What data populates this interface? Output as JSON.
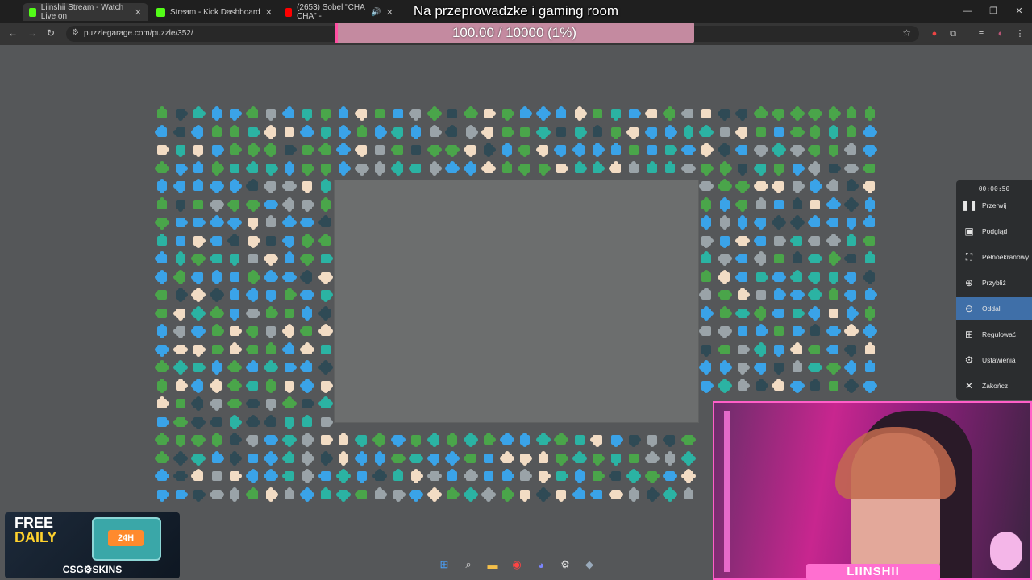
{
  "tabs": [
    {
      "title": "Liinshii Stream - Watch Live on",
      "color": "#53fc18"
    },
    {
      "title": "Stream - Kick Dashboard",
      "color": "#53fc18"
    },
    {
      "title": "(2653) Sobel \"CHA CHA\" - ",
      "color": "#ff0000"
    }
  ],
  "address": {
    "url": "puzzlegarage.com/puzzle/352/"
  },
  "overlay": {
    "title": "Na przeprowadzke i gaming room",
    "goal_text": "100.00 / 10000 (1%)",
    "goal_fraction": 0.01
  },
  "menu": {
    "timer": "00:00:50",
    "items": [
      {
        "label": "Przerwij",
        "icon": "pause-icon"
      },
      {
        "label": "Podgląd",
        "icon": "image-icon"
      },
      {
        "label": "Pełnoekranowy",
        "icon": "fullscreen-icon"
      },
      {
        "label": "Przybliż",
        "icon": "zoom-in-icon"
      },
      {
        "label": "Oddal",
        "icon": "zoom-out-icon",
        "active": true
      },
      {
        "label": "Regulować",
        "icon": "grid-icon"
      },
      {
        "label": "Ustawienia",
        "icon": "gear-icon"
      },
      {
        "label": "Zakończ",
        "icon": "close-icon"
      }
    ]
  },
  "webcam": {
    "name": "LIINSHII"
  },
  "ad": {
    "line1": "FREE",
    "line2": "DAILY",
    "badge": "24H",
    "brand": "CSG⚙SKINS"
  },
  "palette": {
    "cream": "#f2dcc4",
    "blue": "#3aa3e8",
    "teal": "#2bb3a3",
    "green": "#4aa54a",
    "dark": "#2f4a55",
    "grey": "#9aa3a8",
    "menu_active": "#3f6fa8",
    "accent_pink": "#ff4fa2"
  }
}
